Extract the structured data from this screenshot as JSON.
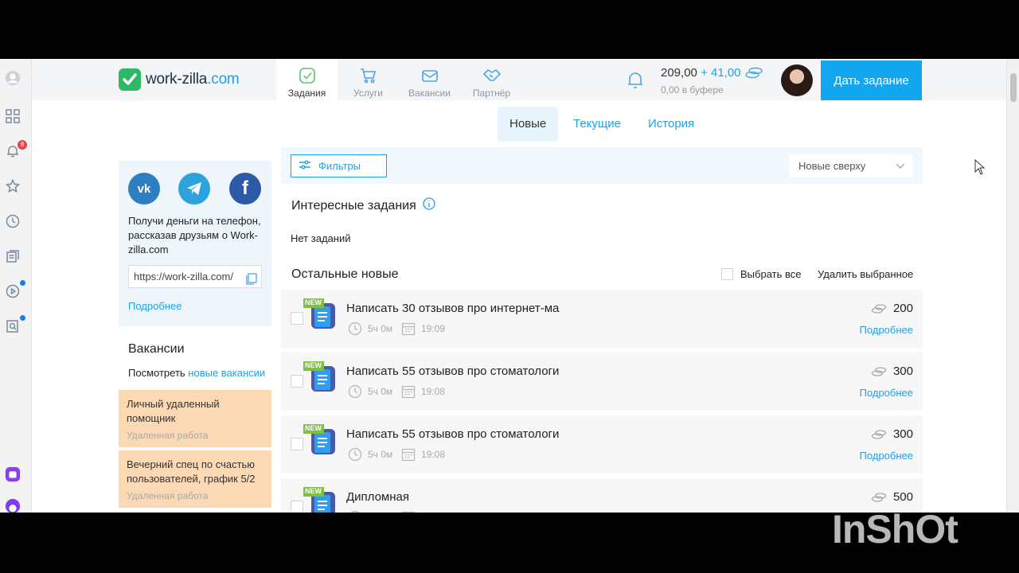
{
  "logo": {
    "prefix": "work-zilla",
    "suffix": ".com"
  },
  "nav": [
    {
      "label": "Задания",
      "icon": "check-square-icon"
    },
    {
      "label": "Услуги",
      "icon": "cart-icon"
    },
    {
      "label": "Вакансии",
      "icon": "envelope-icon"
    },
    {
      "label": "Партнёр",
      "icon": "handshake-icon"
    }
  ],
  "balance": {
    "amount": "209,00",
    "bonus": "+ 41,00",
    "buffer": "0,00 в буфере"
  },
  "give_task_label": "Дать задание",
  "tabs": [
    "Новые",
    "Текущие",
    "История"
  ],
  "browser_sidebar": {
    "notif_badge": "8"
  },
  "share": {
    "text": "Получи деньги на телефон, рассказав друзьям о Work-zilla.com",
    "link": "https://work-zilla.com/",
    "more": "Подробнее",
    "socials": [
      "vk",
      "telegram",
      "facebook"
    ]
  },
  "vacancies": {
    "title": "Вакансии",
    "see_prefix": "Посмотреть",
    "see_link": "новые вакансии",
    "cards": [
      {
        "title": "Личный удаленный помощник",
        "sub": "Удаленная работа"
      },
      {
        "title": "Вечерний спец по счастью пользователей, график 5/2",
        "sub": "Удаленная работа"
      }
    ]
  },
  "filters_label": "Фильтры",
  "sort_label": "Новые сверху",
  "interesting_title": "Интересные задания",
  "no_tasks": "Нет заданий",
  "others_title": "Остальные новые",
  "select_all": "Выбрать все",
  "delete_selected": "Удалить выбранное",
  "new_badge": "NEW",
  "task_more": "Подробнее",
  "tasks": [
    {
      "title": "Написать 30 отзывов про интернет-ма",
      "duration": "5ч 0м",
      "time": "19:09",
      "price": "200"
    },
    {
      "title": "Написать 55 отзывов про стоматологи",
      "duration": "5ч 0м",
      "time": "19:08",
      "price": "300"
    },
    {
      "title": "Написать 55 отзывов про стоматологи",
      "duration": "5ч 0м",
      "time": "19:08",
      "price": "300"
    },
    {
      "title": "Дипломная",
      "duration": "",
      "time": "",
      "price": "500"
    }
  ],
  "watermark": "InShOt",
  "colors": {
    "accent": "#12a6f0",
    "logo_green": "#2fb865",
    "vacancy_card": "#fbd9b5"
  }
}
